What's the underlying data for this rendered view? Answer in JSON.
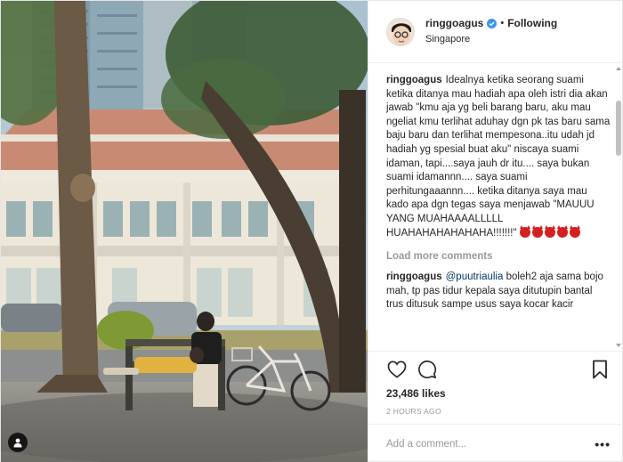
{
  "post": {
    "username": "ringgoagus",
    "follow_status": "Following",
    "separator": "•",
    "location": "Singapore"
  },
  "caption": {
    "username": "ringgoagus",
    "text": "Idealnya ketika seorang suami ketika ditanya mau hadiah apa oleh istri dia akan jawab \"kmu aja yg beli barang baru, aku mau ngeliat kmu terlihat aduhay dgn pk tas baru sama baju baru dan terlihat mempesona..itu udah jd hadiah yg spesial buat aku\" niscaya suami idaman, tapi....saya jauh dr itu.... saya bukan suami idamannn.... saya suami perhitungaaannn.... ketika ditanya saya mau kado apa dgn tegas saya menjawab \"MAUUU YANG MUAHAAAALLLLL HUAHAHAHAHAHAHA!!!!!!!\"",
    "emoji_count": 5,
    "emoji_icon": "smiling-devil-icon"
  },
  "load_more_label": "Load more comments",
  "reply": {
    "username": "ringgoagus",
    "mention": "@puutriaulia",
    "text": " boleh2 aja sama bojo mah, tp pas tidur kepala saya ditutupin bantal trus ditusuk sampe usus saya kocar kacir"
  },
  "actions": {
    "like_icon": "heart-icon",
    "comment_icon": "comment-icon",
    "save_icon": "bookmark-icon"
  },
  "likes_text": "23,486 likes",
  "timestamp": "2 HOURS AGO",
  "add_comment_placeholder": "Add a comment...",
  "more_options": "•••",
  "colors": {
    "text": "#262626",
    "muted": "#999999",
    "verified": "#3897f0",
    "mention": "#003569",
    "emoji": "#d42020"
  }
}
